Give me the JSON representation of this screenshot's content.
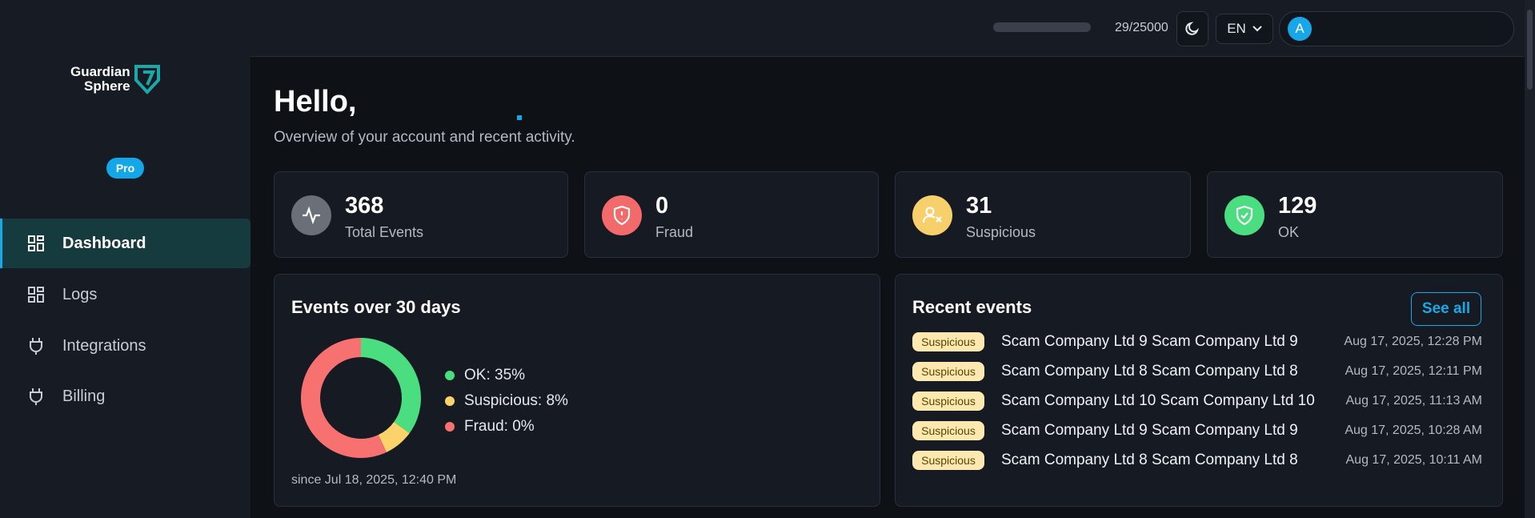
{
  "brand": {
    "line1": "Guardian",
    "line2": "Sphere",
    "plan_badge": "Pro"
  },
  "sidebar": {
    "items": [
      {
        "label": "Dashboard",
        "icon": "dashboard-icon",
        "active": true
      },
      {
        "label": "Logs",
        "icon": "logs-icon",
        "active": false
      },
      {
        "label": "Integrations",
        "icon": "plug-icon",
        "active": false
      },
      {
        "label": "Billing",
        "icon": "plug-icon",
        "active": false
      }
    ]
  },
  "topbar": {
    "usage_text": "29/25000",
    "usage_fraction": 0.00116,
    "theme_icon": "moon-icon",
    "language": "EN",
    "avatar_initial": "A"
  },
  "greeting": {
    "title": "Hello,",
    "subtitle": "Overview of your account and recent activity."
  },
  "stats": [
    {
      "value": "368",
      "label": "Total Events",
      "icon": "activity-icon",
      "color": "#6b6f78"
    },
    {
      "value": "0",
      "label": "Fraud",
      "icon": "shield-alert-icon",
      "color": "#f26a6a"
    },
    {
      "value": "31",
      "label": "Suspicious",
      "icon": "user-x-icon",
      "color": "#f8d06b"
    },
    {
      "value": "129",
      "label": "OK",
      "icon": "shield-check-icon",
      "color": "#4ade80"
    }
  ],
  "events_chart": {
    "title": "Events over 30 days",
    "since": "since Jul 18, 2025, 12:40 PM",
    "legend": [
      {
        "label": "OK: 35%",
        "color": "#4ade80"
      },
      {
        "label": "Suspicious: 8%",
        "color": "#fcd26b"
      },
      {
        "label": "Fraud: 0%",
        "color": "#f87171"
      }
    ]
  },
  "chart_data": {
    "type": "pie",
    "title": "Events over 30 days",
    "categories": [
      "OK",
      "Suspicious",
      "Fraud"
    ],
    "values": [
      35,
      8,
      0
    ],
    "note_visual_split": [
      35,
      8,
      57
    ]
  },
  "recent_events": {
    "title": "Recent events",
    "see_all_label": "See all",
    "items": [
      {
        "status": "Suspicious",
        "name": "Scam Company Ltd 9 Scam Company Ltd 9",
        "time": "Aug 17, 2025, 12:28 PM"
      },
      {
        "status": "Suspicious",
        "name": "Scam Company Ltd 8 Scam Company Ltd 8",
        "time": "Aug 17, 2025, 12:11 PM"
      },
      {
        "status": "Suspicious",
        "name": "Scam Company Ltd 10 Scam Company Ltd 10",
        "time": "Aug 17, 2025, 11:13 AM"
      },
      {
        "status": "Suspicious",
        "name": "Scam Company Ltd 9 Scam Company Ltd 9",
        "time": "Aug 17, 2025, 10:28 AM"
      },
      {
        "status": "Suspicious",
        "name": "Scam Company Ltd 8 Scam Company Ltd 8",
        "time": "Aug 17, 2025, 10:11 AM"
      }
    ]
  }
}
